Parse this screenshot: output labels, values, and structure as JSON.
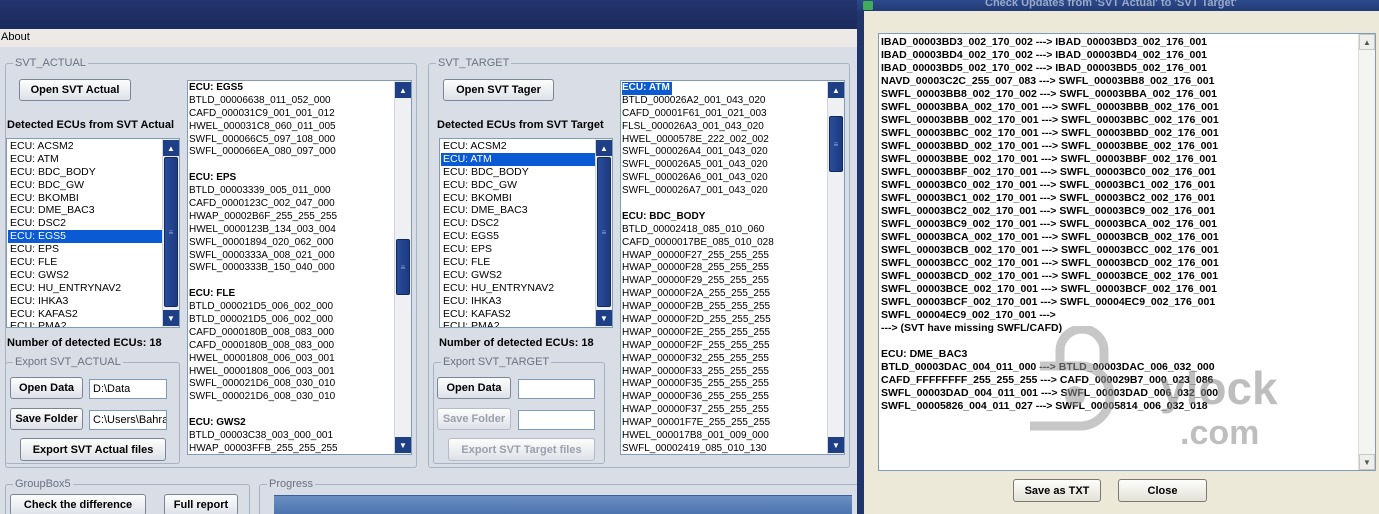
{
  "main": {
    "menu": {
      "about": "About"
    },
    "svt_actual": {
      "group_title": "SVT_ACTUAL",
      "open_button": "Open SVT Actual",
      "detected_label": "Detected ECUs from SVT Actual",
      "ecus": [
        "ECU: ACSM2",
        "ECU: ATM",
        "ECU: BDC_BODY",
        "ECU: BDC_GW",
        "ECU: BKOMBI",
        "ECU: DME_BAC3",
        "ECU: DSC2",
        "ECU: EGS5",
        "ECU: EPS",
        "ECU: FLE",
        "ECU: GWS2",
        "ECU: HU_ENTRYNAV2",
        "ECU: IHKA3",
        "ECU: KAFAS2",
        "ECU: PMA2"
      ],
      "selected_ecu": "ECU: EGS5",
      "details": [
        {
          "t": "ECU: EGS5",
          "h": true
        },
        {
          "t": "BTLD_00006638_011_052_000"
        },
        {
          "t": "CAFD_000031C9_001_001_012"
        },
        {
          "t": "HWEL_000031C8_060_011_005"
        },
        {
          "t": "SWFL_000066C5_097_108_000"
        },
        {
          "t": "SWFL_000066EA_080_097_000"
        },
        {
          "t": ""
        },
        {
          "t": "ECU: EPS",
          "h": true
        },
        {
          "t": "BTLD_00003339_005_011_000"
        },
        {
          "t": "CAFD_0000123C_002_047_000"
        },
        {
          "t": "HWAP_00002B6F_255_255_255"
        },
        {
          "t": "HWEL_0000123B_134_003_004"
        },
        {
          "t": "SWFL_00001894_020_062_000"
        },
        {
          "t": "SWFL_0000333A_008_021_000"
        },
        {
          "t": "SWFL_0000333B_150_040_000"
        },
        {
          "t": ""
        },
        {
          "t": "ECU: FLE",
          "h": true
        },
        {
          "t": "BTLD_000021D5_006_002_000"
        },
        {
          "t": "BTLD_000021D5_006_002_000"
        },
        {
          "t": "CAFD_0000180B_008_083_000"
        },
        {
          "t": "CAFD_0000180B_008_083_000"
        },
        {
          "t": "HWEL_00001808_006_003_001"
        },
        {
          "t": "HWEL_00001808_006_003_001"
        },
        {
          "t": "SWFL_000021D6_008_030_010"
        },
        {
          "t": "SWFL_000021D6_008_030_010"
        },
        {
          "t": ""
        },
        {
          "t": "ECU: GWS2",
          "h": true
        },
        {
          "t": "BTLD_00003C38_003_000_001"
        },
        {
          "t": "HWAP_00003FFB_255_255_255"
        }
      ],
      "count_label": "Number of detected ECUs: 18",
      "export_title": "Export SVT_ACTUAL",
      "open_data_button": "Open Data",
      "open_data_path": "D:\\Data",
      "save_folder_button": "Save Folder",
      "save_folder_path": "C:\\Users\\Bahra",
      "export_button": "Export SVT Actual files"
    },
    "svt_target": {
      "group_title": "SVT_TARGET",
      "open_button": "Open SVT Tager",
      "detected_label": "Detected ECUs from SVT Target",
      "ecus": [
        "ECU: ACSM2",
        "ECU: ATM",
        "ECU: BDC_BODY",
        "ECU: BDC_GW",
        "ECU: BKOMBI",
        "ECU: DME_BAC3",
        "ECU: DSC2",
        "ECU: EGS5",
        "ECU: EPS",
        "ECU: FLE",
        "ECU: GWS2",
        "ECU: HU_ENTRYNAV2",
        "ECU: IHKA3",
        "ECU: KAFAS2",
        "ECU: PMA2"
      ],
      "selected_ecu": "ECU: ATM",
      "details": [
        {
          "t": "ECU: ATM",
          "h": true,
          "sel": true
        },
        {
          "t": "BTLD_000026A2_001_043_020"
        },
        {
          "t": "CAFD_00001F61_001_021_003"
        },
        {
          "t": "FLSL_000026A3_001_043_020"
        },
        {
          "t": "HWEL_0000578E_222_002_002"
        },
        {
          "t": "SWFL_000026A4_001_043_020"
        },
        {
          "t": "SWFL_000026A5_001_043_020"
        },
        {
          "t": "SWFL_000026A6_001_043_020"
        },
        {
          "t": "SWFL_000026A7_001_043_020"
        },
        {
          "t": ""
        },
        {
          "t": "ECU: BDC_BODY",
          "h": true
        },
        {
          "t": "BTLD_00002418_085_010_060"
        },
        {
          "t": "CAFD_0000017BE_085_010_028"
        },
        {
          "t": "HWAP_00000F27_255_255_255"
        },
        {
          "t": "HWAP_00000F28_255_255_255"
        },
        {
          "t": "HWAP_00000F29_255_255_255"
        },
        {
          "t": "HWAP_00000F2A_255_255_255"
        },
        {
          "t": "HWAP_00000F2B_255_255_255"
        },
        {
          "t": "HWAP_00000F2D_255_255_255"
        },
        {
          "t": "HWAP_00000F2E_255_255_255"
        },
        {
          "t": "HWAP_00000F2F_255_255_255"
        },
        {
          "t": "HWAP_00000F32_255_255_255"
        },
        {
          "t": "HWAP_00000F33_255_255_255"
        },
        {
          "t": "HWAP_00000F35_255_255_255"
        },
        {
          "t": "HWAP_00000F36_255_255_255"
        },
        {
          "t": "HWAP_00000F37_255_255_255"
        },
        {
          "t": "HWAP_00001F7E_255_255_255"
        },
        {
          "t": "HWEL_000017B8_001_009_000"
        },
        {
          "t": "SWFL_00002419_085_010_130"
        }
      ],
      "count_label": "Number of detected ECUs: 18",
      "export_title": "Export SVT_TARGET",
      "open_data_button": "Open Data",
      "save_folder_button": "Save Folder",
      "export_button": "Export SVT Target files"
    },
    "groupbox5": {
      "title": "GroupBox5",
      "check_button": "Check the difference",
      "full_report_button": "Full report"
    },
    "progress": {
      "title": "Progress"
    }
  },
  "dialog": {
    "title": "Check Updates from  'SVT Actual'  to  'SVT Target'",
    "lines": [
      "IBAD_00003BD3_002_170_002 ---> IBAD_00003BD3_002_176_001",
      "IBAD_00003BD4_002_170_002 ---> IBAD_00003BD4_002_176_001",
      "IBAD_00003BD5_002_170_002 ---> IBAD_00003BD5_002_176_001",
      "NAVD_00003C2C_255_007_083 ---> SWFL_00003BB8_002_176_001",
      "SWFL_00003BB8_002_170_002 ---> SWFL_00003BBA_002_176_001",
      "SWFL_00003BBA_002_170_001 ---> SWFL_00003BBB_002_176_001",
      "SWFL_00003BBB_002_170_001 ---> SWFL_00003BBC_002_176_001",
      "SWFL_00003BBC_002_170_001 ---> SWFL_00003BBD_002_176_001",
      "SWFL_00003BBD_002_170_001 ---> SWFL_00003BBE_002_176_001",
      "SWFL_00003BBE_002_170_001 ---> SWFL_00003BBF_002_176_001",
      "SWFL_00003BBF_002_170_001 ---> SWFL_00003BC0_002_176_001",
      "SWFL_00003BC0_002_170_001 ---> SWFL_00003BC1_002_176_001",
      "SWFL_00003BC1_002_170_001 ---> SWFL_00003BC2_002_176_001",
      "SWFL_00003BC2_002_170_001 ---> SWFL_00003BC9_002_176_001",
      "SWFL_00003BC9_002_170_001 ---> SWFL_00003BCA_002_176_001",
      "SWFL_00003BCA_002_170_001 ---> SWFL_00003BCB_002_176_001",
      "SWFL_00003BCB_002_170_001 ---> SWFL_00003BCC_002_176_001",
      "SWFL_00003BCC_002_170_001 ---> SWFL_00003BCD_002_176_001",
      "SWFL_00003BCD_002_170_001 ---> SWFL_00003BCE_002_176_001",
      "SWFL_00003BCE_002_170_001 ---> SWFL_00003BCF_002_176_001",
      "SWFL_00003BCF_002_170_001 ---> SWFL_00004EC9_002_176_001",
      "SWFL_00004EC9_002_170_001 --->",
      " ---> (SVT have missing SWFL/CAFD)",
      "",
      "ECU: DME_BAC3",
      "BTLD_00003DAC_004_011_000 ---> BTLD_00003DAC_006_032_000",
      "CAFD_FFFFFFFF_255_255_255 ---> CAFD_000029B7_000_023_086",
      "SWFL_00003DAD_004_011_001 ---> SWFL_00003DAD_006_032_000",
      "SWFL_00005826_004_011_027 ---> SWFL_00005814_006_032_018"
    ],
    "save_button": "Save as TXT",
    "close_button": "Close"
  },
  "watermark": {
    "text": "ylock",
    "subtext": ".com"
  }
}
